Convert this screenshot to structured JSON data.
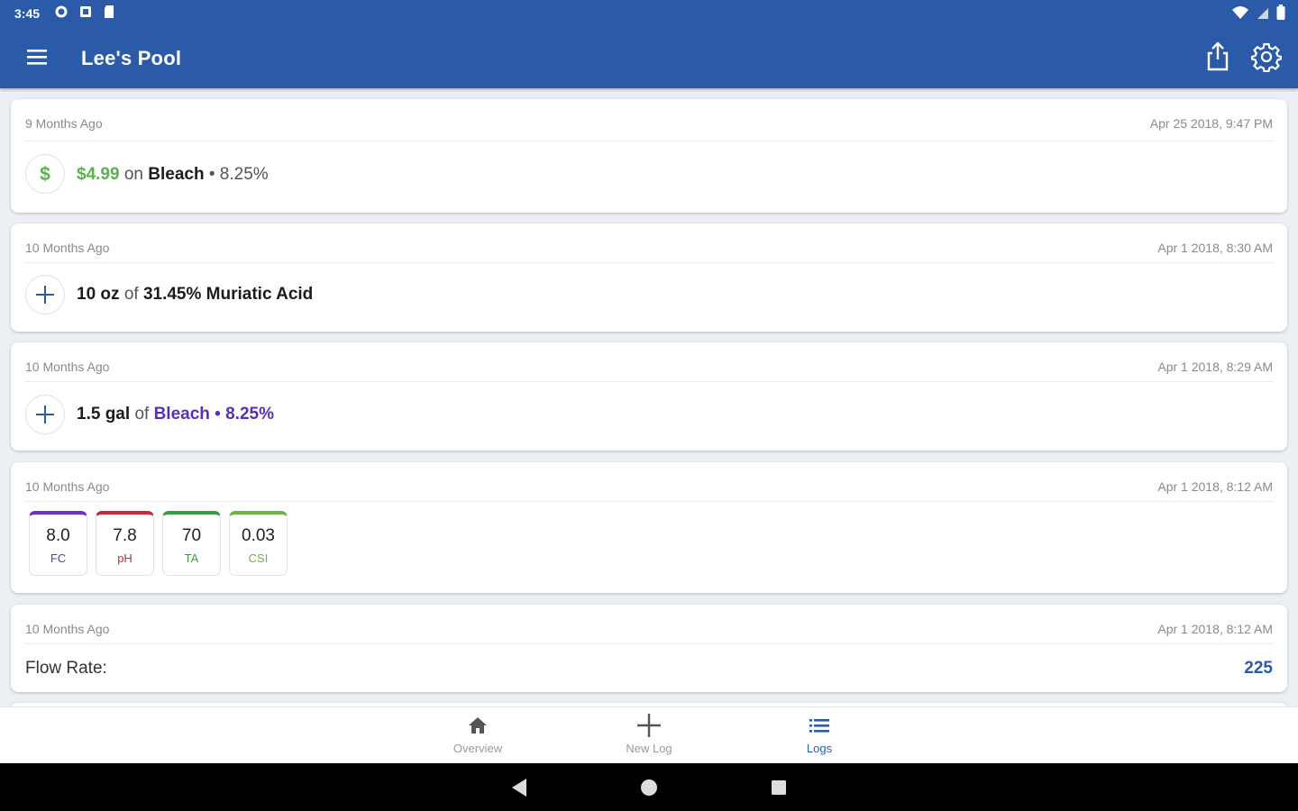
{
  "status_bar": {
    "time": "3:45"
  },
  "app_bar": {
    "title": "Lee's Pool"
  },
  "entries": [
    {
      "ago": "9 Months Ago",
      "date": "Apr 25 2018, 9:47 PM",
      "amount": "$4.99",
      "on": "on",
      "item": "Bleach",
      "separator": "•",
      "concentration": "8.25%"
    },
    {
      "ago": "10 Months Ago",
      "date": "Apr 1 2018, 8:30 AM",
      "quantity": "10 oz",
      "of": "of",
      "chemical": "31.45% Muriatic Acid"
    },
    {
      "ago": "10 Months Ago",
      "date": "Apr 1 2018, 8:29 AM",
      "quantity": "1.5 gal",
      "of": "of",
      "chemical": "Bleach",
      "separator": "•",
      "concentration": "8.25%"
    },
    {
      "ago": "10 Months Ago",
      "date": "Apr 1 2018, 8:12 AM",
      "readings": [
        {
          "value": "8.0",
          "label": "FC",
          "color": "#6a33c4"
        },
        {
          "value": "7.8",
          "label": "pH",
          "color": "#c8283a"
        },
        {
          "value": "70",
          "label": "TA",
          "color": "#3c9a3c"
        },
        {
          "value": "0.03",
          "label": "CSI",
          "color": "#6fb24a"
        }
      ]
    },
    {
      "ago": "10 Months Ago",
      "date": "Apr 1 2018, 8:12 AM",
      "label": "Flow Rate:",
      "value": "225"
    }
  ],
  "bottom_nav": [
    {
      "label": "Overview",
      "icon": "home-icon"
    },
    {
      "label": "New Log",
      "icon": "plus-icon"
    },
    {
      "label": "Logs",
      "icon": "list-icon",
      "active": true
    }
  ],
  "colors": {
    "primary": "#2a5aa8",
    "money": "#5bb04f",
    "chemical": "#5a2fb8"
  }
}
